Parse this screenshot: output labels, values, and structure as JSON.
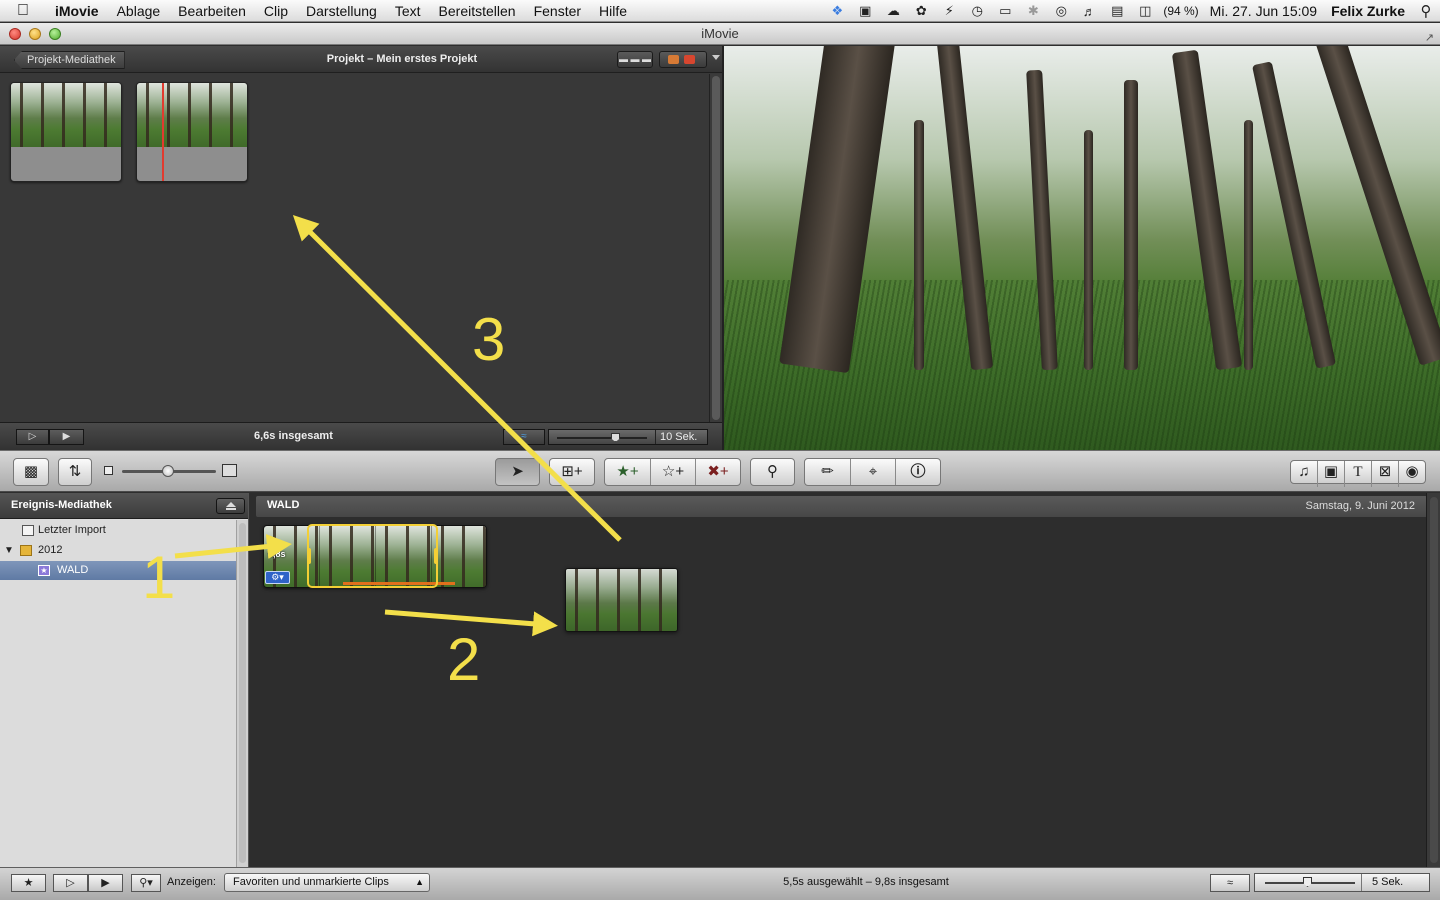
{
  "menubar": {
    "app": "iMovie",
    "items": [
      "Ablage",
      "Bearbeiten",
      "Clip",
      "Darstellung",
      "Text",
      "Bereitstellen",
      "Fenster",
      "Hilfe"
    ],
    "battery": "(94 %)",
    "datetime": "Mi. 27. Jun  15:09",
    "user": "Felix Zurke"
  },
  "window": {
    "title": "iMovie"
  },
  "project": {
    "back_label": "Projekt-Mediathek",
    "title": "Projekt – Mein erstes Projekt",
    "total": "6,6s insgesamt",
    "zoom_label": "10 Sek."
  },
  "event_library": {
    "title": "Ereignis-Mediathek",
    "items": [
      {
        "label": "Letzter Import"
      },
      {
        "label": "2012"
      },
      {
        "label": "WALD"
      }
    ]
  },
  "event_browser": {
    "event_name": "WALD",
    "date": "Samstag, 9. Juni 2012",
    "clip_duration": "9,8s"
  },
  "annotations": {
    "label_1": "1",
    "label_2": "2",
    "label_3": "3"
  },
  "bottombar": {
    "show_label": "Anzeigen:",
    "filter_value": "Favoriten und unmarkierte Clips",
    "status": "5,5s ausgewählt – 9,8s insgesamt",
    "zoom_label": "5 Sek."
  },
  "colors": {
    "annotation": "#f3df4a",
    "selection": "#f3cf35",
    "favorite": "#e0701c",
    "playhead": "#e23b2f"
  }
}
